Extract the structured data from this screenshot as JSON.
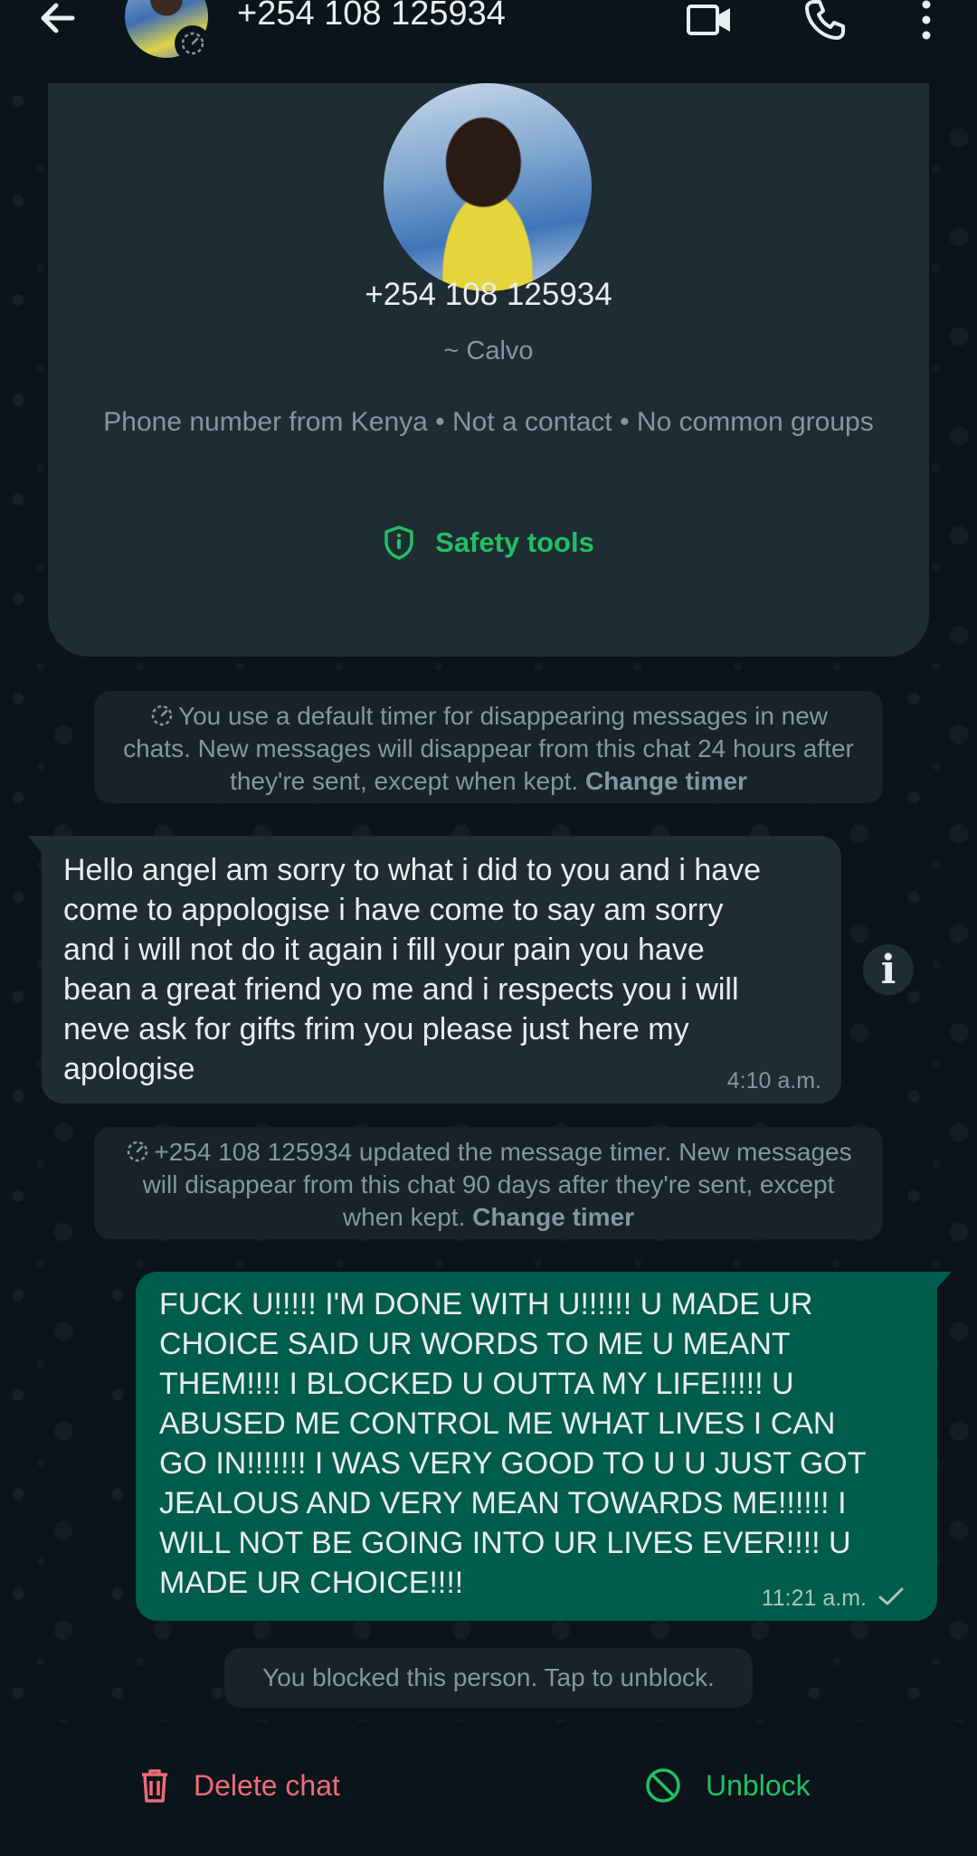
{
  "header": {
    "title": "+254 108 125934"
  },
  "profile": {
    "phone": "+254 108 125934",
    "push_name": "~ Calvo",
    "info": "Phone number from Kenya • Not a contact • No common groups",
    "safety_tools_label": "Safety tools"
  },
  "notices": {
    "default_timer_text": "You use a default timer for disappearing messages in new chats. New messages will disappear from this chat 24 hours after they're sent, except when kept.",
    "default_timer_link": "Change timer",
    "updated_timer_text": "+254 108 125934 updated the message timer. New messages will disappear from this chat 90 days after they're sent, except when kept.",
    "updated_timer_link": "Change timer",
    "blocked_text": "You blocked this person. Tap to unblock."
  },
  "messages": [
    {
      "direction": "incoming",
      "text": "Hello angel am sorry to what i did to you and i have\ncome to appologise i have come to say am sorry\nand i will not do it again i fill your pain you have\nbean a great friend yo me and i respects you i will\nneve ask for gifts frim you please just here my\napologise",
      "time": "4:10 a.m."
    },
    {
      "direction": "outgoing",
      "text": "FUCK U!!!!! I'M DONE WITH U!!!!!! U MADE UR\nCHOICE SAID UR WORDS TO ME U MEANT\nTHEM!!!! I BLOCKED U OUTTA MY LIFE!!!!! U\nABUSED ME CONTROL ME WHAT LIVES I CAN\nGO IN!!!!!!!   I WAS VERY GOOD TO U U JUST GOT\nJEALOUS AND VERY MEAN TOWARDS ME!!!!!! I\nWILL NOT BE GOING INTO UR LIVES EVER!!!! U\nMADE UR CHOICE!!!!",
      "time": "11:21 a.m.",
      "status": "sent"
    }
  ],
  "info_button_glyph": "i",
  "bottom_bar": {
    "delete_label": "Delete chat",
    "unblock_label": "Unblock"
  },
  "colors": {
    "background": "#0b141a",
    "incoming_bubble": "#202c33",
    "outgoing_bubble": "#005c4b",
    "accent_green": "#21c063",
    "danger_red": "#ef6b7a",
    "muted_text": "#8696a0"
  },
  "icons": {
    "back": "arrow-left-icon",
    "video": "video-camera-icon",
    "call": "phone-icon",
    "menu": "more-vertical-icon",
    "timer": "disappearing-timer-icon",
    "shield": "shield-icon",
    "trash": "trash-icon",
    "unblock": "block-circle-icon",
    "tick": "check-icon"
  }
}
